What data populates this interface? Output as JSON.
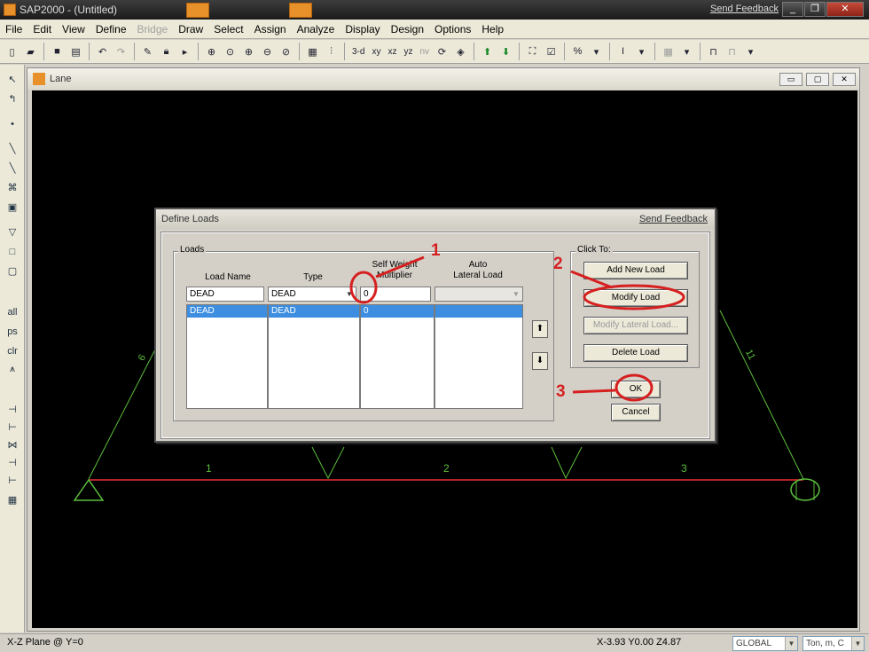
{
  "window": {
    "title": "SAP2000 - (Untitled)",
    "feedback": "Send Feedback",
    "minimize": "_",
    "restore": "❐",
    "close": "✕"
  },
  "menu": [
    "File",
    "Edit",
    "View",
    "Define",
    "Bridge",
    "Draw",
    "Select",
    "Assign",
    "Analyze",
    "Display",
    "Design",
    "Options",
    "Help"
  ],
  "toolbar": {
    "view_labels": [
      "3-d",
      "xy",
      "xz",
      "yz",
      "nv"
    ]
  },
  "mdi": {
    "title": "Lane",
    "min": "▭",
    "max": "▢",
    "close": "✕"
  },
  "model": {
    "member_labels": [
      "1",
      "2",
      "3"
    ],
    "left_label": "6",
    "right_label": "11",
    "colors": {
      "beam": "#b22222",
      "line": "#5cbf3c",
      "background": "#000000"
    }
  },
  "dialog": {
    "title": "Define Loads",
    "feedback": "Send Feedback",
    "loads_group": "Loads",
    "columns": {
      "load_name": "Load Name",
      "type": "Type",
      "self_weight_1": "Self Weight",
      "self_weight_2": "Multiplier",
      "auto_1": "Auto",
      "auto_2": "Lateral Load"
    },
    "entry": {
      "load_name": "DEAD",
      "type": "DEAD",
      "multiplier": "0",
      "auto_lateral": ""
    },
    "rows": [
      {
        "load_name": "DEAD",
        "type": "DEAD",
        "multiplier": "0",
        "auto_lateral": ""
      }
    ],
    "click_to_group": "Click To:",
    "buttons": {
      "add": "Add New Load",
      "modify": "Modify Load",
      "modify_lateral": "Modify Lateral Load...",
      "delete": "Delete Load",
      "ok": "OK",
      "cancel": "Cancel"
    }
  },
  "annotations": [
    "1",
    "2",
    "3"
  ],
  "annotation_color": "#d62020",
  "status": {
    "plane": "X-Z Plane @ Y=0",
    "coords": "X-3.93  Y0.00  Z4.87",
    "coord_system": "GLOBAL",
    "units": "Ton, m, C"
  }
}
